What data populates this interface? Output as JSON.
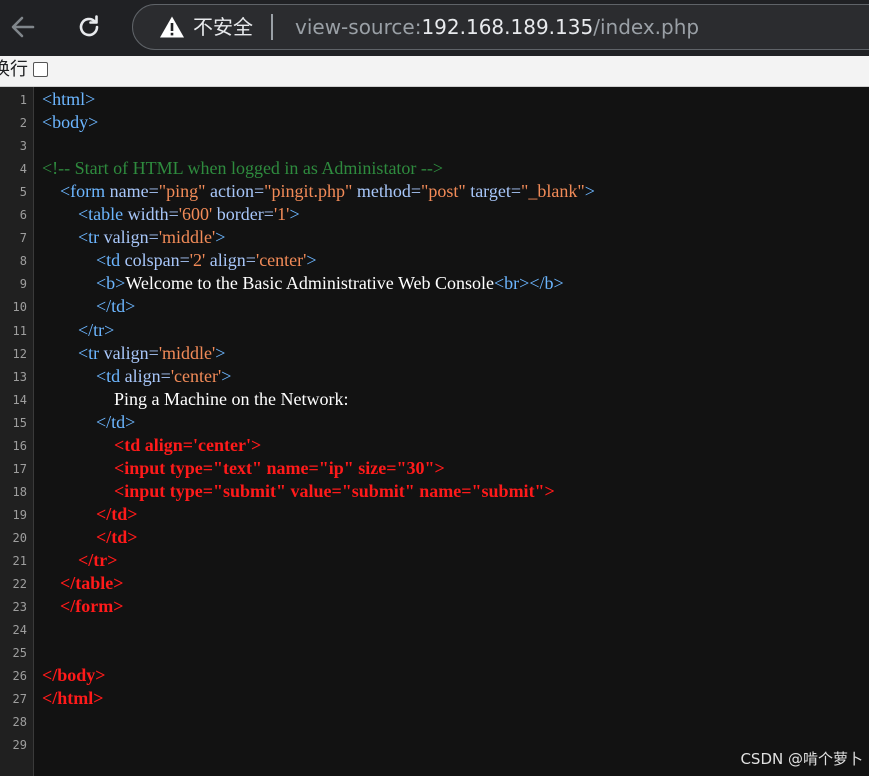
{
  "browser": {
    "security_label": "不安全",
    "url_scheme": "view-source:",
    "url_host": "192.168.189.135",
    "url_path": "/index.php",
    "wrap_label": "换行"
  },
  "source_lines": [
    {
      "n": "1",
      "parts": [
        {
          "c": "tag",
          "t": "<html>"
        }
      ]
    },
    {
      "n": "2",
      "parts": [
        {
          "c": "tag",
          "t": "<body>"
        }
      ]
    },
    {
      "n": "3",
      "parts": []
    },
    {
      "n": "4",
      "parts": [
        {
          "c": "cmt",
          "t": "<!-- Start of HTML when logged in as Administator -->"
        }
      ]
    },
    {
      "n": "5",
      "parts": [
        {
          "c": "txt",
          "t": "    "
        },
        {
          "c": "tag",
          "t": "<form "
        },
        {
          "c": "attr",
          "t": "name="
        },
        {
          "c": "val",
          "t": "\"ping\""
        },
        {
          "c": "attr",
          "t": " action="
        },
        {
          "c": "val",
          "t": "\"pingit.php\""
        },
        {
          "c": "attr",
          "t": " method="
        },
        {
          "c": "val",
          "t": "\"post\""
        },
        {
          "c": "attr",
          "t": " target="
        },
        {
          "c": "val",
          "t": "\"_blank\""
        },
        {
          "c": "tag",
          "t": ">"
        }
      ]
    },
    {
      "n": "6",
      "parts": [
        {
          "c": "txt",
          "t": "        "
        },
        {
          "c": "tag",
          "t": "<table "
        },
        {
          "c": "attr",
          "t": "width="
        },
        {
          "c": "val",
          "t": "'600'"
        },
        {
          "c": "attr",
          "t": " border="
        },
        {
          "c": "val",
          "t": "'1'"
        },
        {
          "c": "tag",
          "t": ">"
        }
      ]
    },
    {
      "n": "7",
      "parts": [
        {
          "c": "txt",
          "t": "        "
        },
        {
          "c": "tag",
          "t": "<tr "
        },
        {
          "c": "attr",
          "t": "valign="
        },
        {
          "c": "val",
          "t": "'middle'"
        },
        {
          "c": "tag",
          "t": ">"
        }
      ]
    },
    {
      "n": "8",
      "parts": [
        {
          "c": "txt",
          "t": "            "
        },
        {
          "c": "tag",
          "t": "<td "
        },
        {
          "c": "attr",
          "t": "colspan="
        },
        {
          "c": "val",
          "t": "'2'"
        },
        {
          "c": "attr",
          "t": " align="
        },
        {
          "c": "val",
          "t": "'center'"
        },
        {
          "c": "tag",
          "t": ">"
        }
      ]
    },
    {
      "n": "9",
      "parts": [
        {
          "c": "txt",
          "t": "            "
        },
        {
          "c": "tag",
          "t": "<b>"
        },
        {
          "c": "txt",
          "t": "Welcome to the Basic Administrative Web Console"
        },
        {
          "c": "tag",
          "t": "<br></b>"
        }
      ]
    },
    {
      "n": "10",
      "parts": [
        {
          "c": "txt",
          "t": "            "
        },
        {
          "c": "tag",
          "t": "</td>"
        }
      ]
    },
    {
      "n": "11",
      "parts": [
        {
          "c": "txt",
          "t": "        "
        },
        {
          "c": "tag",
          "t": "</tr>"
        }
      ]
    },
    {
      "n": "12",
      "parts": [
        {
          "c": "txt",
          "t": "        "
        },
        {
          "c": "tag",
          "t": "<tr "
        },
        {
          "c": "attr",
          "t": "valign="
        },
        {
          "c": "val",
          "t": "'middle'"
        },
        {
          "c": "tag",
          "t": ">"
        }
      ]
    },
    {
      "n": "13",
      "parts": [
        {
          "c": "txt",
          "t": "            "
        },
        {
          "c": "tag",
          "t": "<td "
        },
        {
          "c": "attr",
          "t": "align="
        },
        {
          "c": "val",
          "t": "'center'"
        },
        {
          "c": "tag",
          "t": ">"
        }
      ]
    },
    {
      "n": "14",
      "parts": [
        {
          "c": "txt",
          "t": "                Ping a Machine on the Network:"
        }
      ]
    },
    {
      "n": "15",
      "parts": [
        {
          "c": "txt",
          "t": "            "
        },
        {
          "c": "tag",
          "t": "</td>"
        }
      ]
    },
    {
      "n": "16",
      "parts": [
        {
          "c": "red",
          "t": "                <td align='center'>"
        }
      ]
    },
    {
      "n": "17",
      "parts": [
        {
          "c": "red",
          "t": "                <input type=\"text\" name=\"ip\" size=\"30\">"
        }
      ]
    },
    {
      "n": "18",
      "parts": [
        {
          "c": "red",
          "t": "                <input type=\"submit\" value=\"submit\" name=\"submit\">"
        }
      ]
    },
    {
      "n": "19",
      "parts": [
        {
          "c": "red",
          "t": "            </td>"
        }
      ]
    },
    {
      "n": "20",
      "parts": [
        {
          "c": "red",
          "t": "            </td>"
        }
      ]
    },
    {
      "n": "21",
      "parts": [
        {
          "c": "red",
          "t": "        </tr>"
        }
      ]
    },
    {
      "n": "22",
      "parts": [
        {
          "c": "red",
          "t": "    </table>"
        }
      ]
    },
    {
      "n": "23",
      "parts": [
        {
          "c": "red",
          "t": "    </form>"
        }
      ]
    },
    {
      "n": "24",
      "parts": []
    },
    {
      "n": "25",
      "parts": []
    },
    {
      "n": "26",
      "parts": [
        {
          "c": "red",
          "t": "</body>"
        }
      ]
    },
    {
      "n": "27",
      "parts": [
        {
          "c": "red",
          "t": "</html>"
        }
      ]
    },
    {
      "n": "28",
      "parts": []
    },
    {
      "n": "29",
      "parts": []
    }
  ],
  "watermark": "CSDN @啃个萝卜",
  "colors": {
    "tag": "#6cb6ff",
    "attr": "#a8c7fa",
    "value": "#f28b58",
    "comment": "#2e8b3e",
    "highlight": "#ff1a1a"
  },
  "icons": {
    "back": "arrow-left-icon",
    "reload": "reload-icon",
    "security": "warning-triangle-icon"
  }
}
